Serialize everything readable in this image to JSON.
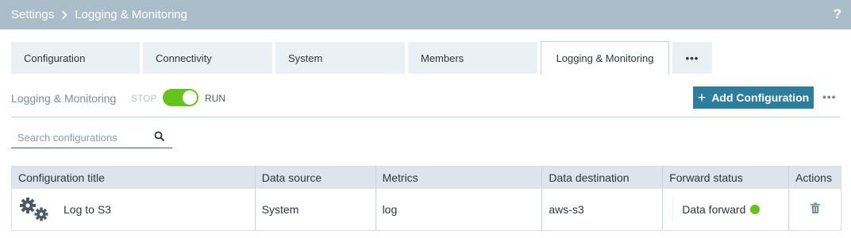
{
  "header": {
    "breadcrumb_root": "Settings",
    "breadcrumb_current": "Logging & Monitoring",
    "help_label": "?"
  },
  "tabs": [
    {
      "label": "Configuration"
    },
    {
      "label": "Connectivity"
    },
    {
      "label": "System"
    },
    {
      "label": "Members"
    },
    {
      "label": "Logging & Monitoring",
      "active": true
    },
    {
      "label": "•••"
    }
  ],
  "toolbar": {
    "section_label": "Logging & Monitoring",
    "stop_label": "STOP",
    "run_label": "RUN",
    "toggle_state": "run",
    "add_button_plus": "+",
    "add_button_label": "Add Configuration",
    "more_label": "•••"
  },
  "search": {
    "placeholder": "Search configurations",
    "value": ""
  },
  "table": {
    "columns": [
      "Configuration title",
      "Data source",
      "Metrics",
      "Data destination",
      "Forward status",
      "Actions"
    ],
    "rows": [
      {
        "icon": "gears-icon",
        "title": "Log to S3",
        "data_source": "System",
        "metrics": "log",
        "data_destination": "aws-s3",
        "forward_status": "Data forward",
        "status_color": "#65c31e",
        "action_icon": "trash-icon"
      }
    ]
  },
  "colors": {
    "header_bg": "#aabdc9",
    "accent": "#2d7e9c",
    "toggle_on": "#65c31e",
    "table_header_bg": "#dde4ea"
  }
}
